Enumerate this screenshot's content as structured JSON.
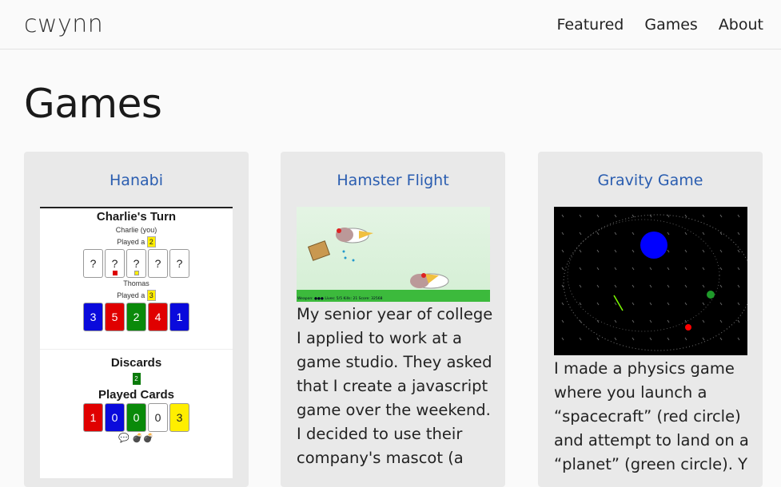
{
  "brand": "cwynn",
  "nav": {
    "featured": "Featured",
    "games": "Games",
    "about": "About"
  },
  "page_title": "Games",
  "cards": {
    "hanabi": {
      "title": "Hanabi",
      "turn": "Charlie's Turn",
      "player_you": "Charlie (you)",
      "played_a": "Played a",
      "played_value_1": "2",
      "unknown_card": "?",
      "other_player": "Thomas",
      "played_value_2": "3",
      "thomas_cards": [
        {
          "value": "3",
          "color": "#0a0adc"
        },
        {
          "value": "5",
          "color": "#e00000"
        },
        {
          "value": "2",
          "color": "#0a8a0a"
        },
        {
          "value": "4",
          "color": "#e00000"
        },
        {
          "value": "1",
          "color": "#0a0adc"
        }
      ],
      "discards_label": "Discards",
      "discard_value": "2",
      "played_cards_label": "Played Cards",
      "played_cards": [
        {
          "value": "1",
          "color": "#e00000"
        },
        {
          "value": "0",
          "color": "#0a0adc"
        },
        {
          "value": "0",
          "color": "#0a8a0a"
        },
        {
          "value": "0",
          "color": "#ffffff"
        },
        {
          "value": "3",
          "color": "#ffee00"
        }
      ],
      "marks": "💬 💣💣"
    },
    "hamster": {
      "title": "Hamster Flight",
      "hud": "Weapon: ●●● Lives: 5/5  Kills: 21  Score: 32568",
      "description": "My senior year of college I applied to work at a game studio. They asked that I create a javascript game over the weekend. I decided to use their company's mascot (a"
    },
    "gravity": {
      "title": "Gravity Game",
      "description": "I made a physics game where you launch a “spacecraft” (red circle) and attempt to land on a “planet” (green circle). Y"
    }
  },
  "colors": {
    "link": "#2a5db0",
    "card_bg": "#e9e9e9",
    "planet_blue": "#0000ff",
    "planet_green": "#1f9a2a",
    "ship_red": "#ff0000"
  }
}
